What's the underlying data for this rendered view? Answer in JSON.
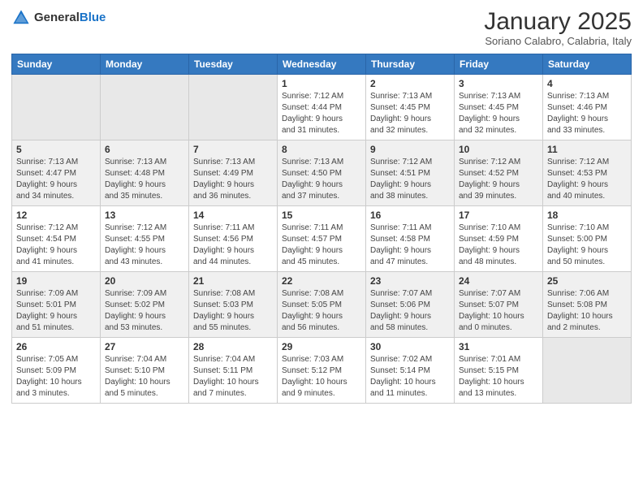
{
  "logo": {
    "general": "General",
    "blue": "Blue"
  },
  "header": {
    "month": "January 2025",
    "location": "Soriano Calabro, Calabria, Italy"
  },
  "weekdays": [
    "Sunday",
    "Monday",
    "Tuesday",
    "Wednesday",
    "Thursday",
    "Friday",
    "Saturday"
  ],
  "weeks": [
    [
      {
        "day": "",
        "info": ""
      },
      {
        "day": "",
        "info": ""
      },
      {
        "day": "",
        "info": ""
      },
      {
        "day": "1",
        "info": "Sunrise: 7:12 AM\nSunset: 4:44 PM\nDaylight: 9 hours\nand 31 minutes."
      },
      {
        "day": "2",
        "info": "Sunrise: 7:13 AM\nSunset: 4:45 PM\nDaylight: 9 hours\nand 32 minutes."
      },
      {
        "day": "3",
        "info": "Sunrise: 7:13 AM\nSunset: 4:45 PM\nDaylight: 9 hours\nand 32 minutes."
      },
      {
        "day": "4",
        "info": "Sunrise: 7:13 AM\nSunset: 4:46 PM\nDaylight: 9 hours\nand 33 minutes."
      }
    ],
    [
      {
        "day": "5",
        "info": "Sunrise: 7:13 AM\nSunset: 4:47 PM\nDaylight: 9 hours\nand 34 minutes."
      },
      {
        "day": "6",
        "info": "Sunrise: 7:13 AM\nSunset: 4:48 PM\nDaylight: 9 hours\nand 35 minutes."
      },
      {
        "day": "7",
        "info": "Sunrise: 7:13 AM\nSunset: 4:49 PM\nDaylight: 9 hours\nand 36 minutes."
      },
      {
        "day": "8",
        "info": "Sunrise: 7:13 AM\nSunset: 4:50 PM\nDaylight: 9 hours\nand 37 minutes."
      },
      {
        "day": "9",
        "info": "Sunrise: 7:12 AM\nSunset: 4:51 PM\nDaylight: 9 hours\nand 38 minutes."
      },
      {
        "day": "10",
        "info": "Sunrise: 7:12 AM\nSunset: 4:52 PM\nDaylight: 9 hours\nand 39 minutes."
      },
      {
        "day": "11",
        "info": "Sunrise: 7:12 AM\nSunset: 4:53 PM\nDaylight: 9 hours\nand 40 minutes."
      }
    ],
    [
      {
        "day": "12",
        "info": "Sunrise: 7:12 AM\nSunset: 4:54 PM\nDaylight: 9 hours\nand 41 minutes."
      },
      {
        "day": "13",
        "info": "Sunrise: 7:12 AM\nSunset: 4:55 PM\nDaylight: 9 hours\nand 43 minutes."
      },
      {
        "day": "14",
        "info": "Sunrise: 7:11 AM\nSunset: 4:56 PM\nDaylight: 9 hours\nand 44 minutes."
      },
      {
        "day": "15",
        "info": "Sunrise: 7:11 AM\nSunset: 4:57 PM\nDaylight: 9 hours\nand 45 minutes."
      },
      {
        "day": "16",
        "info": "Sunrise: 7:11 AM\nSunset: 4:58 PM\nDaylight: 9 hours\nand 47 minutes."
      },
      {
        "day": "17",
        "info": "Sunrise: 7:10 AM\nSunset: 4:59 PM\nDaylight: 9 hours\nand 48 minutes."
      },
      {
        "day": "18",
        "info": "Sunrise: 7:10 AM\nSunset: 5:00 PM\nDaylight: 9 hours\nand 50 minutes."
      }
    ],
    [
      {
        "day": "19",
        "info": "Sunrise: 7:09 AM\nSunset: 5:01 PM\nDaylight: 9 hours\nand 51 minutes."
      },
      {
        "day": "20",
        "info": "Sunrise: 7:09 AM\nSunset: 5:02 PM\nDaylight: 9 hours\nand 53 minutes."
      },
      {
        "day": "21",
        "info": "Sunrise: 7:08 AM\nSunset: 5:03 PM\nDaylight: 9 hours\nand 55 minutes."
      },
      {
        "day": "22",
        "info": "Sunrise: 7:08 AM\nSunset: 5:05 PM\nDaylight: 9 hours\nand 56 minutes."
      },
      {
        "day": "23",
        "info": "Sunrise: 7:07 AM\nSunset: 5:06 PM\nDaylight: 9 hours\nand 58 minutes."
      },
      {
        "day": "24",
        "info": "Sunrise: 7:07 AM\nSunset: 5:07 PM\nDaylight: 10 hours\nand 0 minutes."
      },
      {
        "day": "25",
        "info": "Sunrise: 7:06 AM\nSunset: 5:08 PM\nDaylight: 10 hours\nand 2 minutes."
      }
    ],
    [
      {
        "day": "26",
        "info": "Sunrise: 7:05 AM\nSunset: 5:09 PM\nDaylight: 10 hours\nand 3 minutes."
      },
      {
        "day": "27",
        "info": "Sunrise: 7:04 AM\nSunset: 5:10 PM\nDaylight: 10 hours\nand 5 minutes."
      },
      {
        "day": "28",
        "info": "Sunrise: 7:04 AM\nSunset: 5:11 PM\nDaylight: 10 hours\nand 7 minutes."
      },
      {
        "day": "29",
        "info": "Sunrise: 7:03 AM\nSunset: 5:12 PM\nDaylight: 10 hours\nand 9 minutes."
      },
      {
        "day": "30",
        "info": "Sunrise: 7:02 AM\nSunset: 5:14 PM\nDaylight: 10 hours\nand 11 minutes."
      },
      {
        "day": "31",
        "info": "Sunrise: 7:01 AM\nSunset: 5:15 PM\nDaylight: 10 hours\nand 13 minutes."
      },
      {
        "day": "",
        "info": ""
      }
    ]
  ]
}
